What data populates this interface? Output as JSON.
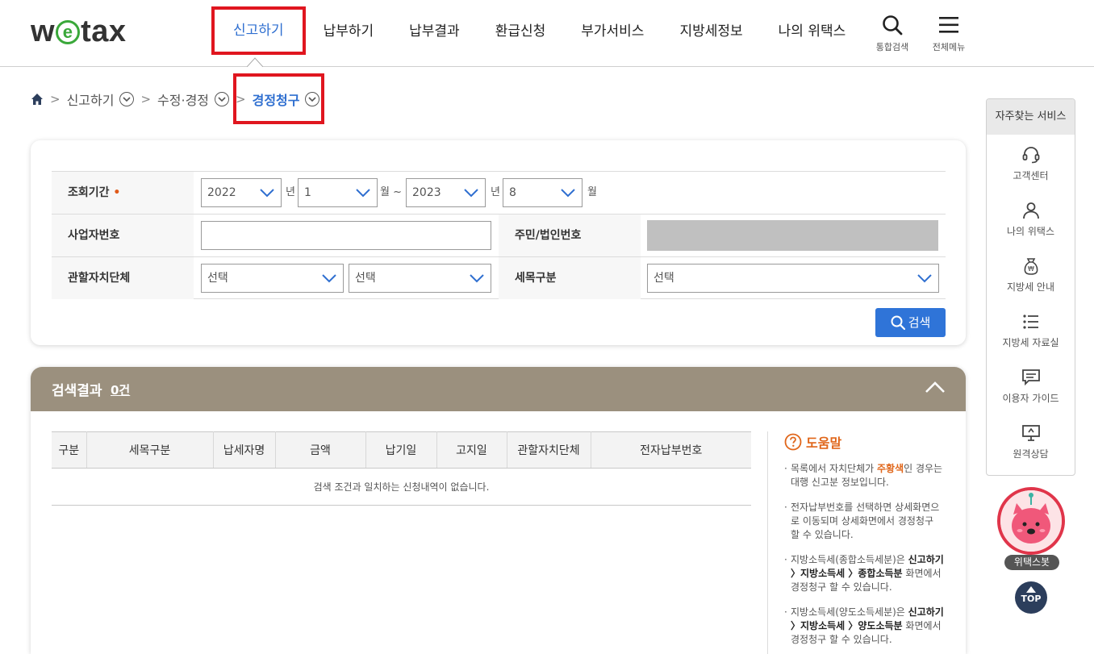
{
  "header": {
    "logo_prefix": "w",
    "logo_e": "e",
    "logo_suffix": "tax",
    "nav": [
      "신고하기",
      "납부하기",
      "납부결과",
      "환급신청",
      "부가서비스",
      "지방세정보",
      "나의 위택스"
    ],
    "active_nav": "신고하기",
    "search_label": "통합검색",
    "menu_label": "전체메뉴"
  },
  "breadcrumb": {
    "level1": "신고하기",
    "level2": "수정·경정",
    "current": "경정청구"
  },
  "search": {
    "period_label": "조회기간",
    "required_mark": "•",
    "start_year": "2022",
    "year_unit": "년",
    "start_month": "1",
    "month_unit_range": "월 ~",
    "end_year": "2023",
    "end_month": "8",
    "month_unit": "월",
    "biz_no_label": "사업자번호",
    "biz_no_value": "",
    "resident_no_label": "주민/법인번호",
    "jurisdiction_label": "관할자치단체",
    "jurisdiction_1": "선택",
    "jurisdiction_2": "선택",
    "tax_type_label": "세목구분",
    "tax_type_value": "선택",
    "search_button": "검색"
  },
  "results": {
    "title": "검색결과",
    "count": "0건",
    "columns": [
      "구분",
      "세목구분",
      "납세자명",
      "금액",
      "납기일",
      "고지일",
      "관할자치단체",
      "전자납부번호"
    ],
    "empty_message": "검색 조건과 일치하는 신청내역이 없습니다."
  },
  "help": {
    "title": "도움말",
    "item1_a": "목록에서 자치단체가 ",
    "item1_hl": "주황색",
    "item1_b": "인 경우는 대행 신고분 정보입니다.",
    "item2": "전자납부번호를 선택하면 상세화면으로 이동되며 상세화면에서 경정청구 할 수 있습니다.",
    "item3_a": "지방소득세(종합소득세분)은 ",
    "item3_b": "신고하기 〉지방소득세 〉종합소득분",
    "item3_c": " 화면에서 경정청구 할 수 있습니다.",
    "item4_a": "지방소득세(양도소득세분)은 ",
    "item4_b": "신고하기 〉지방소득세 〉양도소득분",
    "item4_c": " 화면에서 경정청구 할 수 있습니다."
  },
  "quick_menu": {
    "title": "자주찾는 서비스",
    "items": [
      "고객센터",
      "나의 위택스",
      "지방세 안내",
      "지방세 자료실",
      "이용자 가이드",
      "원격상담"
    ]
  },
  "chatbot_label": "위택스봇",
  "top_label": "TOP",
  "colors": {
    "accent_blue": "#2f74d8",
    "highlight_red": "#e0161f",
    "results_header": "#9b907e",
    "help_orange": "#e0661a"
  }
}
